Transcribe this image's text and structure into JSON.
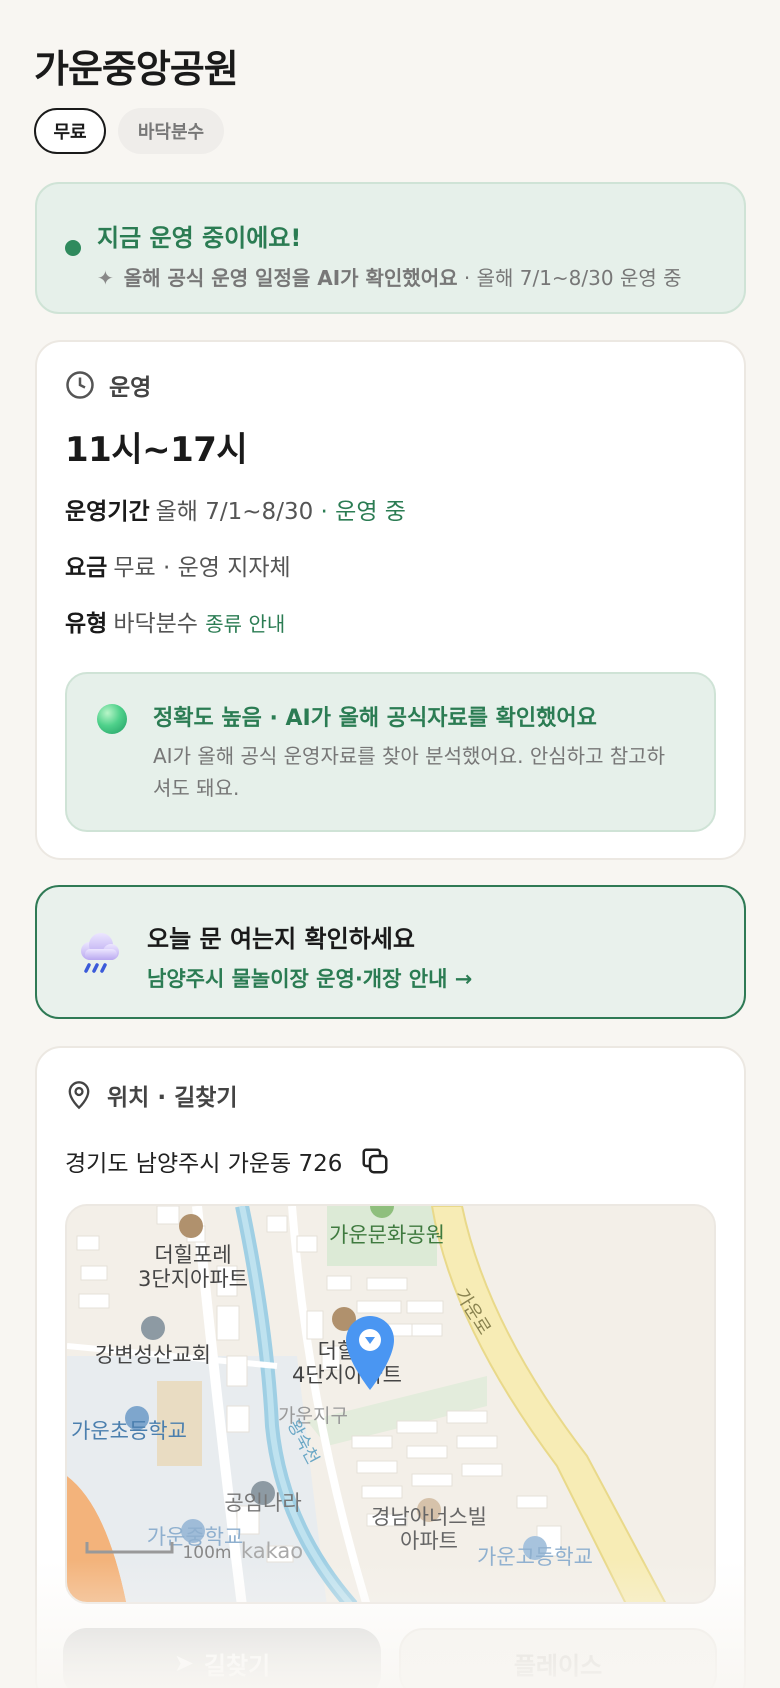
{
  "header": {
    "title": "가운중앙공원",
    "chips": [
      "무료",
      "바닥분수"
    ]
  },
  "status": {
    "title": "지금 운영 중이에요!",
    "sparkle_icon": "sparkle-icon",
    "ai_note": "올해 공식 운영 일정을 AI가 확인했어요",
    "period_note": "· 올해 7/1~8/30 운영 중",
    "dot_color": "#2f8a5d"
  },
  "operation": {
    "section_label": "운영",
    "hours": "11시~17시",
    "period_label": "운영기간",
    "period_value": "올해 7/1~8/30",
    "period_status": "· 운영 중",
    "fee_label": "요금",
    "fee_value": "무료 · 운영 지자체",
    "type_label": "유형",
    "type_value": "바닥분수",
    "type_link": "종류 안내",
    "accuracy_title": "정확도 높음 · AI가 올해 공식자료를 확인했어요",
    "accuracy_text": "AI가 올해 공식 운영자료를 찾아 분석했어요. 안심하고 참고하셔도 돼요."
  },
  "notice": {
    "title": "오늘 문 여는지 확인하세요",
    "link": "남양주시 물놀이장 운영·개장 안내 →",
    "icon": "rain-cloud-icon"
  },
  "location": {
    "section_label": "위치 · 길찾기",
    "address": "경기도 남양주시 가운동 726",
    "map_labels": {
      "park": "가운문화공원",
      "apt3_line1": "더힐포레",
      "apt3_line2": "3단지아파트",
      "church": "강변성산교회",
      "apt4_line1": "더힐",
      "apt4_line2": "4단지아파트",
      "elem_school": "가운초등학교",
      "district": "가운지구",
      "stream": "왕숙천",
      "road": "가운로",
      "shop": "공임나라",
      "apt_kn_line1": "경남아너스빌",
      "apt_kn_line2": "아파트",
      "mid_school": "가운중학교",
      "high_school": "가운고등학교",
      "scale": "100m",
      "brand": "kakao"
    }
  },
  "actions": {
    "directions": "길찾기",
    "place": "플레이스"
  }
}
